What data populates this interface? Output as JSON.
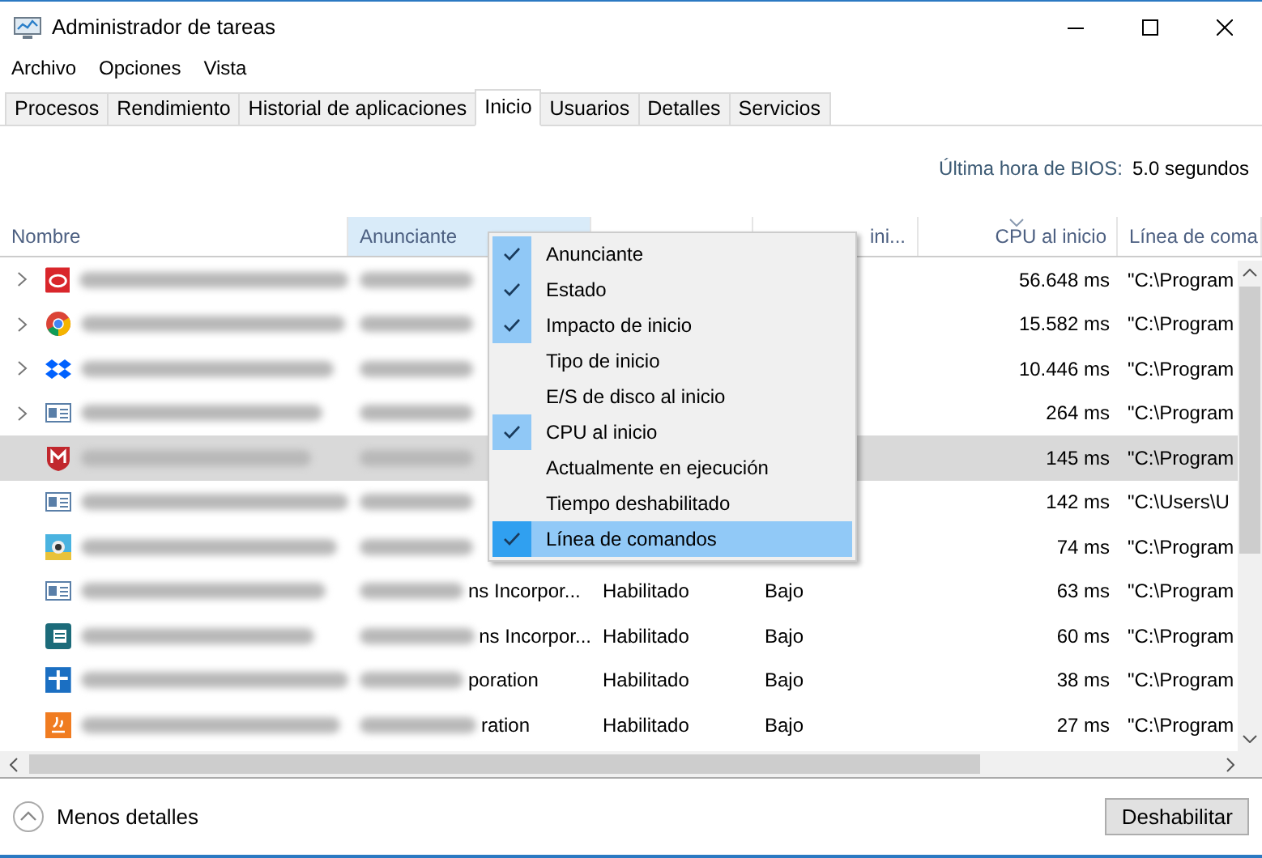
{
  "window": {
    "title": "Administrador de tareas"
  },
  "menu_bar": [
    "Archivo",
    "Opciones",
    "Vista"
  ],
  "tabs": [
    {
      "label": "Procesos",
      "selected": false
    },
    {
      "label": "Rendimiento",
      "selected": false
    },
    {
      "label": "Historial de aplicaciones",
      "selected": false
    },
    {
      "label": "Inicio",
      "selected": true
    },
    {
      "label": "Usuarios",
      "selected": false
    },
    {
      "label": "Detalles",
      "selected": false
    },
    {
      "label": "Servicios",
      "selected": false
    }
  ],
  "bios": {
    "label": "Última hora de BIOS:",
    "value": "5.0 segundos"
  },
  "table": {
    "columns": [
      {
        "label": "Nombre",
        "highlighted": false,
        "sorted": false
      },
      {
        "label": "Anunciante",
        "highlighted": true,
        "sorted": false
      },
      {
        "highlighted": false,
        "sorted": false
      },
      {
        "label": "ini...",
        "highlighted": false,
        "sorted": false
      },
      {
        "label": "CPU al inicio",
        "highlighted": false,
        "sorted": true
      },
      {
        "label": "Línea de coma",
        "highlighted": false,
        "sorted": false
      }
    ],
    "rows": [
      {
        "expandable": true,
        "selected": false,
        "cpu": "56.648 ms",
        "command": "\"C:\\Program"
      },
      {
        "expandable": true,
        "selected": false,
        "cpu": "15.582 ms",
        "command": "\"C:\\Program"
      },
      {
        "expandable": true,
        "selected": false,
        "cpu": "10.446 ms",
        "command": "\"C:\\Program"
      },
      {
        "expandable": true,
        "selected": false,
        "cpu": "264 ms",
        "command": "\"C:\\Program"
      },
      {
        "expandable": false,
        "selected": true,
        "cpu": "145 ms",
        "command": "\"C:\\Program"
      },
      {
        "expandable": false,
        "selected": false,
        "cpu": "142 ms",
        "command": "\"C:\\Users\\U"
      },
      {
        "expandable": false,
        "selected": false,
        "cpu": "74 ms",
        "command": "\"C:\\Program"
      },
      {
        "expandable": false,
        "selected": false,
        "publisher": "ns Incorpor...",
        "status": "Habilitado",
        "impact": "Bajo",
        "cpu": "63 ms",
        "command": "\"C:\\Program"
      },
      {
        "expandable": false,
        "selected": false,
        "publisher": "ns Incorpor...",
        "status": "Habilitado",
        "impact": "Bajo",
        "cpu": "60 ms",
        "command": "\"C:\\Program"
      },
      {
        "expandable": false,
        "selected": false,
        "publisher": "poration",
        "status": "Habilitado",
        "impact": "Bajo",
        "cpu": "38 ms",
        "command": "\"C:\\Program"
      },
      {
        "expandable": false,
        "selected": false,
        "publisher": "ration",
        "status": "Habilitado",
        "impact": "Bajo",
        "cpu": "27 ms",
        "command": "\"C:\\Program"
      }
    ]
  },
  "context_menu": [
    {
      "label": "Anunciante",
      "checked": true,
      "selected": false
    },
    {
      "label": "Estado",
      "checked": true,
      "selected": false
    },
    {
      "label": "Impacto de inicio",
      "checked": true,
      "selected": false
    },
    {
      "label": "Tipo de inicio",
      "checked": false,
      "selected": false
    },
    {
      "label": "E/S de disco al inicio",
      "checked": false,
      "selected": false
    },
    {
      "label": "CPU al inicio",
      "checked": true,
      "selected": false
    },
    {
      "label": "Actualmente en ejecución",
      "checked": false,
      "selected": false
    },
    {
      "label": "Tiempo deshabilitado",
      "checked": false,
      "selected": false
    },
    {
      "label": "Línea de comandos",
      "checked": true,
      "selected": true
    }
  ],
  "footer": {
    "details_link": "Menos detalles",
    "button": "Deshabilitar"
  }
}
